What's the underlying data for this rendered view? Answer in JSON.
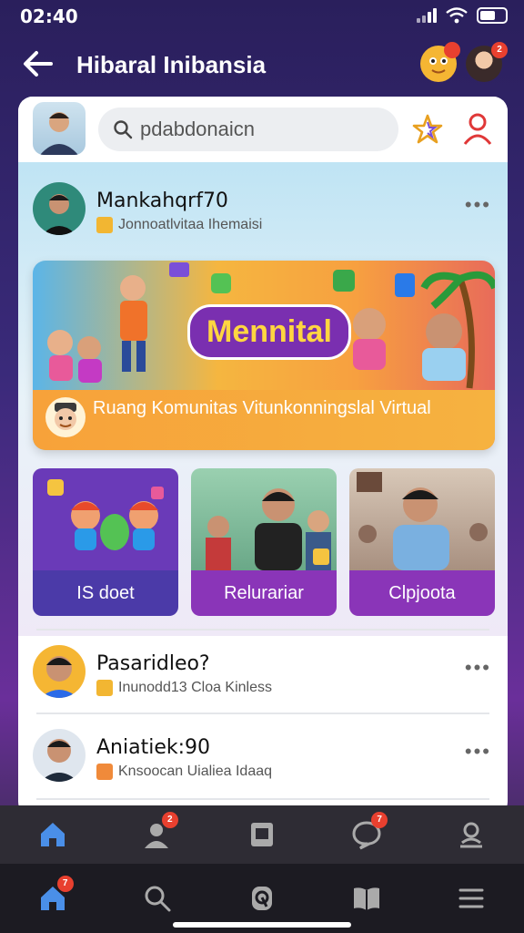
{
  "status": {
    "time": "02:40"
  },
  "header": {
    "title": "Hibaral Inibansia",
    "notif_badge": "",
    "avatar_badge": "2"
  },
  "search": {
    "value": "pdabdonaicn"
  },
  "posts": [
    {
      "name": "Mankahqrf70",
      "subtitle": "Jonnoatlvitaa Ihemaisi"
    },
    {
      "name": "Pasaridleo?",
      "subtitle": "Inunodd13 Cloa Kinless"
    },
    {
      "name": "Aniatiek:90",
      "subtitle": "Knsoocan Uialiea Idaaq"
    }
  ],
  "banner": {
    "pill": "Mennital",
    "caption": "Ruang Komunitas Vitunkonningslal Virtual"
  },
  "tiles": [
    {
      "label": "IS doet",
      "color": "#4b3aa8"
    },
    {
      "label": "Relurariar",
      "color": "#8a35b8"
    },
    {
      "label": "Clpjoota",
      "color": "#8a35b8"
    }
  ],
  "nav_top": [
    {
      "icon": "home-icon",
      "badge": ""
    },
    {
      "icon": "people-icon",
      "badge": "2"
    },
    {
      "icon": "pages-icon",
      "badge": ""
    },
    {
      "icon": "chat-icon",
      "badge": "7"
    },
    {
      "icon": "profile-icon",
      "badge": ""
    }
  ],
  "nav_bottom": [
    {
      "icon": "home-icon",
      "badge": "7"
    },
    {
      "icon": "search-icon",
      "badge": ""
    },
    {
      "icon": "create-icon",
      "badge": ""
    },
    {
      "icon": "book-icon",
      "badge": ""
    },
    {
      "icon": "menu-icon",
      "badge": ""
    }
  ],
  "colors": {
    "accent": "#7a2fb0",
    "banner_foot": "#f6b240",
    "nav_active": "#4a8fe8",
    "badge": "#e8402f"
  }
}
